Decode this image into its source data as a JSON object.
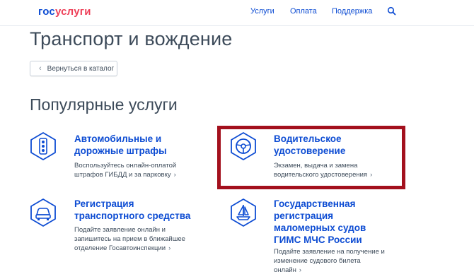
{
  "header": {
    "logo_part1": "гос",
    "logo_part2": "услуги",
    "nav": [
      "Услуги",
      "Оплата",
      "Поддержка"
    ],
    "search_icon": "search-icon"
  },
  "page_title": "Транспорт и вождение",
  "back_button": "Вернуться в каталог",
  "section_title": "Популярные услуги",
  "services": [
    {
      "title": [
        "Автомобильные и",
        "дорожные штрафы"
      ],
      "desc": [
        "Воспользуйтесь онлайн-оплатой",
        "штрафов ГИБДД и за парковку"
      ],
      "icon": "traffic-light-icon"
    },
    {
      "title": [
        "Водительское",
        "удостоверение"
      ],
      "desc": [
        "Экзамен, выдача и замена",
        "водительского удостоверения"
      ],
      "icon": "steering-wheel-icon"
    },
    {
      "title": [
        "Регистрация",
        "транспортного средства"
      ],
      "desc": [
        "Подайте заявление онлайн и",
        "запишитесь на прием в ближайшее",
        "отделение Госавтоинспекции"
      ],
      "icon": "car-icon"
    },
    {
      "title": [
        "Государственная",
        "регистрация",
        "маломерных судов",
        "ГИМС МЧС России"
      ],
      "desc": [
        "Подайте заявление на получение и",
        "изменение судового билета",
        "онлайн"
      ],
      "icon": "boat-icon"
    }
  ],
  "colors": {
    "brand_blue": "#0d4cd3",
    "brand_red": "#ee3f58",
    "highlight_red": "#a3101d",
    "text": "#3d4b5a"
  }
}
